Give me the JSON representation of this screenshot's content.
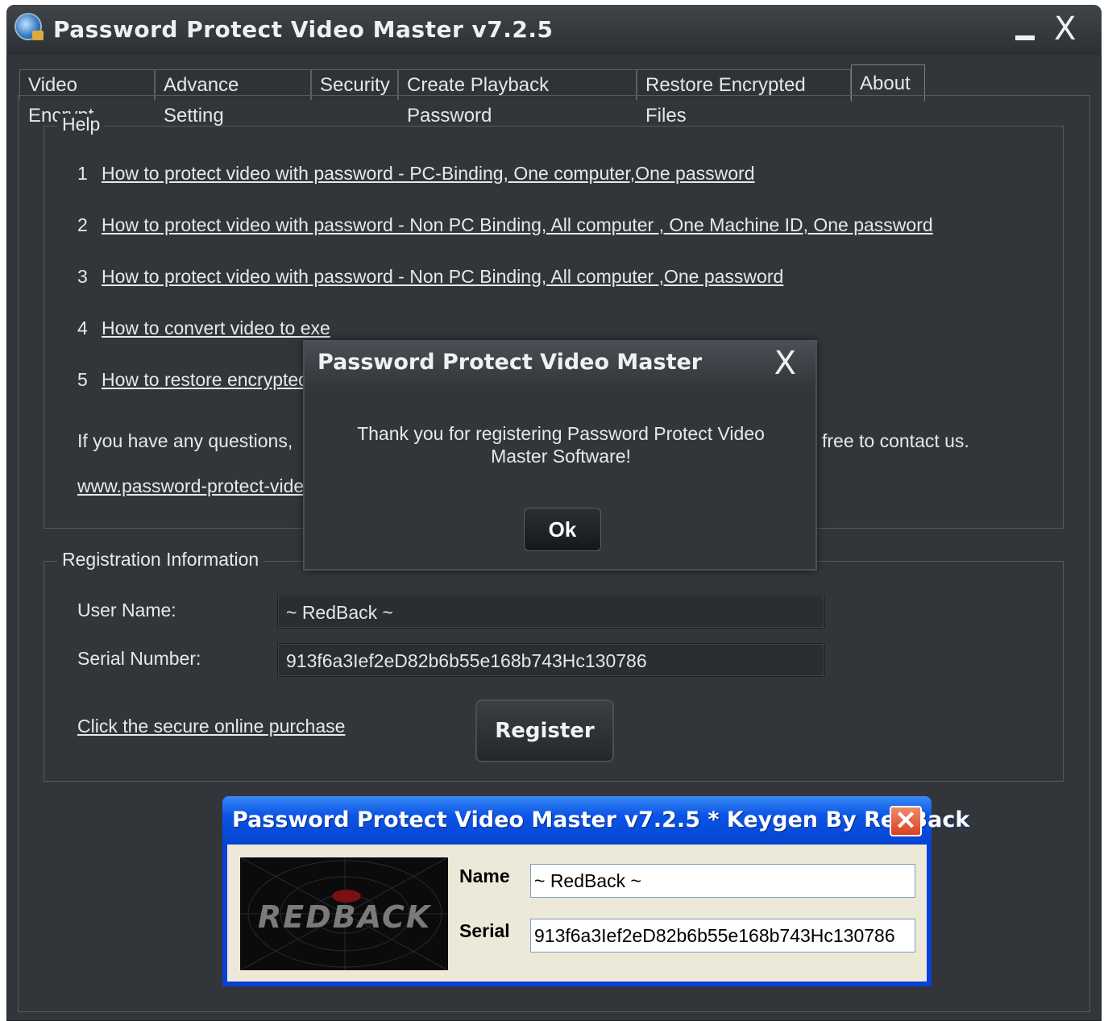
{
  "window": {
    "title": "Password Protect Video Master v7.2.5"
  },
  "tabs": [
    {
      "label": "Video Encrypt"
    },
    {
      "label": "Advance Setting"
    },
    {
      "label": "Security"
    },
    {
      "label": "Create Playback Password"
    },
    {
      "label": "Restore Encrypted Files"
    },
    {
      "label": "About"
    }
  ],
  "help": {
    "legend": "Help",
    "items": [
      {
        "num": "1",
        "text": "How to protect video with password - PC-Binding, One computer,One password"
      },
      {
        "num": "2",
        "text": "How to protect video with password - Non PC Binding, All computer , One Machine ID, One password"
      },
      {
        "num": "3",
        "text": "How to protect video with password - Non PC Binding, All computer ,One password"
      },
      {
        "num": "4",
        "text": "How to convert video to exe"
      },
      {
        "num": "5",
        "text": "How to restore encrypted"
      }
    ],
    "contact_left": "If you have any questions,",
    "contact_right": "free to contact us.",
    "website": "www.password-protect-vide"
  },
  "registration": {
    "legend": "Registration Information",
    "username_label": "User Name:",
    "username_value": "~ RedBack ~",
    "serial_label": "Serial Number:",
    "serial_value": "913f6a3Ief2eD82b6b55e168b743Hc130786",
    "purchase_link": "Click the secure online purchase",
    "register_button": "Register"
  },
  "dialog": {
    "title": "Password Protect Video Master",
    "message": "Thank you for registering Password Protect Video Master Software!",
    "ok_button": "Ok"
  },
  "keygen": {
    "title": "Password Protect Video Master v7.2.5 * Keygen By RedBack",
    "logo_text": "REDBACK",
    "name_label": "Name",
    "name_value": "~ RedBack ~",
    "serial_label": "Serial",
    "serial_value": "913f6a3Ief2eD82b6b55e168b743Hc130786"
  }
}
